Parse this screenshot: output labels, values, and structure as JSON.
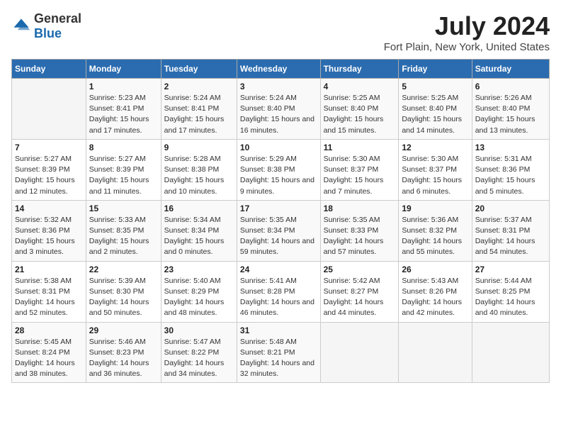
{
  "logo": {
    "general": "General",
    "blue": "Blue"
  },
  "title": "July 2024",
  "subtitle": "Fort Plain, New York, United States",
  "headers": [
    "Sunday",
    "Monday",
    "Tuesday",
    "Wednesday",
    "Thursday",
    "Friday",
    "Saturday"
  ],
  "weeks": [
    [
      {
        "day": "",
        "sunrise": "",
        "sunset": "",
        "daylight": ""
      },
      {
        "day": "1",
        "sunrise": "Sunrise: 5:23 AM",
        "sunset": "Sunset: 8:41 PM",
        "daylight": "Daylight: 15 hours and 17 minutes."
      },
      {
        "day": "2",
        "sunrise": "Sunrise: 5:24 AM",
        "sunset": "Sunset: 8:41 PM",
        "daylight": "Daylight: 15 hours and 17 minutes."
      },
      {
        "day": "3",
        "sunrise": "Sunrise: 5:24 AM",
        "sunset": "Sunset: 8:40 PM",
        "daylight": "Daylight: 15 hours and 16 minutes."
      },
      {
        "day": "4",
        "sunrise": "Sunrise: 5:25 AM",
        "sunset": "Sunset: 8:40 PM",
        "daylight": "Daylight: 15 hours and 15 minutes."
      },
      {
        "day": "5",
        "sunrise": "Sunrise: 5:25 AM",
        "sunset": "Sunset: 8:40 PM",
        "daylight": "Daylight: 15 hours and 14 minutes."
      },
      {
        "day": "6",
        "sunrise": "Sunrise: 5:26 AM",
        "sunset": "Sunset: 8:40 PM",
        "daylight": "Daylight: 15 hours and 13 minutes."
      }
    ],
    [
      {
        "day": "7",
        "sunrise": "Sunrise: 5:27 AM",
        "sunset": "Sunset: 8:39 PM",
        "daylight": "Daylight: 15 hours and 12 minutes."
      },
      {
        "day": "8",
        "sunrise": "Sunrise: 5:27 AM",
        "sunset": "Sunset: 8:39 PM",
        "daylight": "Daylight: 15 hours and 11 minutes."
      },
      {
        "day": "9",
        "sunrise": "Sunrise: 5:28 AM",
        "sunset": "Sunset: 8:38 PM",
        "daylight": "Daylight: 15 hours and 10 minutes."
      },
      {
        "day": "10",
        "sunrise": "Sunrise: 5:29 AM",
        "sunset": "Sunset: 8:38 PM",
        "daylight": "Daylight: 15 hours and 9 minutes."
      },
      {
        "day": "11",
        "sunrise": "Sunrise: 5:30 AM",
        "sunset": "Sunset: 8:37 PM",
        "daylight": "Daylight: 15 hours and 7 minutes."
      },
      {
        "day": "12",
        "sunrise": "Sunrise: 5:30 AM",
        "sunset": "Sunset: 8:37 PM",
        "daylight": "Daylight: 15 hours and 6 minutes."
      },
      {
        "day": "13",
        "sunrise": "Sunrise: 5:31 AM",
        "sunset": "Sunset: 8:36 PM",
        "daylight": "Daylight: 15 hours and 5 minutes."
      }
    ],
    [
      {
        "day": "14",
        "sunrise": "Sunrise: 5:32 AM",
        "sunset": "Sunset: 8:36 PM",
        "daylight": "Daylight: 15 hours and 3 minutes."
      },
      {
        "day": "15",
        "sunrise": "Sunrise: 5:33 AM",
        "sunset": "Sunset: 8:35 PM",
        "daylight": "Daylight: 15 hours and 2 minutes."
      },
      {
        "day": "16",
        "sunrise": "Sunrise: 5:34 AM",
        "sunset": "Sunset: 8:34 PM",
        "daylight": "Daylight: 15 hours and 0 minutes."
      },
      {
        "day": "17",
        "sunrise": "Sunrise: 5:35 AM",
        "sunset": "Sunset: 8:34 PM",
        "daylight": "Daylight: 14 hours and 59 minutes."
      },
      {
        "day": "18",
        "sunrise": "Sunrise: 5:35 AM",
        "sunset": "Sunset: 8:33 PM",
        "daylight": "Daylight: 14 hours and 57 minutes."
      },
      {
        "day": "19",
        "sunrise": "Sunrise: 5:36 AM",
        "sunset": "Sunset: 8:32 PM",
        "daylight": "Daylight: 14 hours and 55 minutes."
      },
      {
        "day": "20",
        "sunrise": "Sunrise: 5:37 AM",
        "sunset": "Sunset: 8:31 PM",
        "daylight": "Daylight: 14 hours and 54 minutes."
      }
    ],
    [
      {
        "day": "21",
        "sunrise": "Sunrise: 5:38 AM",
        "sunset": "Sunset: 8:31 PM",
        "daylight": "Daylight: 14 hours and 52 minutes."
      },
      {
        "day": "22",
        "sunrise": "Sunrise: 5:39 AM",
        "sunset": "Sunset: 8:30 PM",
        "daylight": "Daylight: 14 hours and 50 minutes."
      },
      {
        "day": "23",
        "sunrise": "Sunrise: 5:40 AM",
        "sunset": "Sunset: 8:29 PM",
        "daylight": "Daylight: 14 hours and 48 minutes."
      },
      {
        "day": "24",
        "sunrise": "Sunrise: 5:41 AM",
        "sunset": "Sunset: 8:28 PM",
        "daylight": "Daylight: 14 hours and 46 minutes."
      },
      {
        "day": "25",
        "sunrise": "Sunrise: 5:42 AM",
        "sunset": "Sunset: 8:27 PM",
        "daylight": "Daylight: 14 hours and 44 minutes."
      },
      {
        "day": "26",
        "sunrise": "Sunrise: 5:43 AM",
        "sunset": "Sunset: 8:26 PM",
        "daylight": "Daylight: 14 hours and 42 minutes."
      },
      {
        "day": "27",
        "sunrise": "Sunrise: 5:44 AM",
        "sunset": "Sunset: 8:25 PM",
        "daylight": "Daylight: 14 hours and 40 minutes."
      }
    ],
    [
      {
        "day": "28",
        "sunrise": "Sunrise: 5:45 AM",
        "sunset": "Sunset: 8:24 PM",
        "daylight": "Daylight: 14 hours and 38 minutes."
      },
      {
        "day": "29",
        "sunrise": "Sunrise: 5:46 AM",
        "sunset": "Sunset: 8:23 PM",
        "daylight": "Daylight: 14 hours and 36 minutes."
      },
      {
        "day": "30",
        "sunrise": "Sunrise: 5:47 AM",
        "sunset": "Sunset: 8:22 PM",
        "daylight": "Daylight: 14 hours and 34 minutes."
      },
      {
        "day": "31",
        "sunrise": "Sunrise: 5:48 AM",
        "sunset": "Sunset: 8:21 PM",
        "daylight": "Daylight: 14 hours and 32 minutes."
      },
      {
        "day": "",
        "sunrise": "",
        "sunset": "",
        "daylight": ""
      },
      {
        "day": "",
        "sunrise": "",
        "sunset": "",
        "daylight": ""
      },
      {
        "day": "",
        "sunrise": "",
        "sunset": "",
        "daylight": ""
      }
    ]
  ]
}
